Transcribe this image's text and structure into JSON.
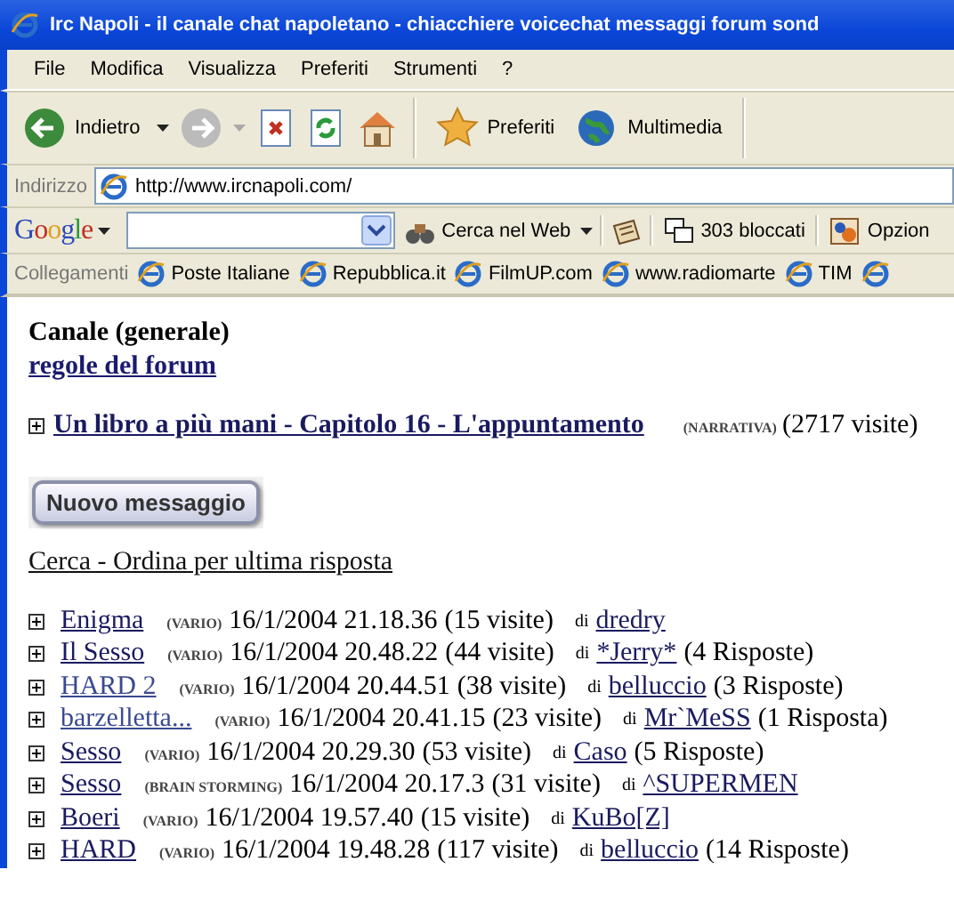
{
  "window": {
    "title": "Irc Napoli - il canale chat napoletano - chiacchiere voicechat messaggi forum sond"
  },
  "menu": [
    "File",
    "Modifica",
    "Visualizza",
    "Preferiti",
    "Strumenti",
    "?"
  ],
  "toolbar": {
    "back": "Indietro",
    "favorites": "Preferiti",
    "media": "Multimedia"
  },
  "address": {
    "label": "Indirizzo",
    "url": "http://www.ircnapoli.com/"
  },
  "google_bar": {
    "logo": "Google",
    "search_button": "Cerca nel Web",
    "blocked": "303 bloccati",
    "options": "Opzion"
  },
  "links_bar": {
    "label": "Collegamenti",
    "links": [
      "Poste Italiane",
      "Repubblica.it",
      "FilmUP.com",
      "www.radiomarte",
      "TIM"
    ]
  },
  "page": {
    "heading": "Canale (generale)",
    "rules_link": "regole del forum",
    "featured": {
      "expanded": false,
      "title": "Un libro a più mani - Capitolo 16 - L'appuntamento",
      "category": "(NARRATIVA)",
      "visits": "(2717 visite)"
    },
    "new_button": "Nuovo messaggio",
    "search_link": "Cerca - Ordina per ultima risposta",
    "threads": [
      {
        "expanded": false,
        "visited": false,
        "title": "Enigma",
        "category": "(VARIO)",
        "date": "16/1/2004 21.18.36",
        "visits": "(15 visite)",
        "by": "di",
        "author": "dredry"
      },
      {
        "expanded": false,
        "visited": false,
        "title": "Il Sesso",
        "category": "(VARIO)",
        "date": "16/1/2004 20.48.22",
        "visits": "(44 visite)",
        "by": "di",
        "author": "*Jerry*",
        "replies": "(4 Risposte)"
      },
      {
        "expanded": false,
        "visited": true,
        "title": "HARD 2",
        "category": "(VARIO)",
        "date": "16/1/2004 20.44.51",
        "visits": "(38 visite)",
        "by": "di",
        "author": "belluccio",
        "replies": "(3 Risposte)"
      },
      {
        "expanded": false,
        "visited": true,
        "title": "barzelletta...",
        "category": "(VARIO)",
        "date": "16/1/2004 20.41.15",
        "visits": "(23 visite)",
        "by": "di",
        "author": "Mr`MeSS",
        "replies": "(1 Risposta)"
      },
      {
        "expanded": false,
        "visited": false,
        "title": "Sesso",
        "category": "(VARIO)",
        "date": "16/1/2004 20.29.30",
        "visits": "(53 visite)",
        "by": "di",
        "author": "Caso",
        "replies": "(5 Risposte)"
      },
      {
        "expanded": false,
        "visited": false,
        "title": "Sesso",
        "category": "(BRAIN STORMING)",
        "date": "16/1/2004 20.17.3",
        "visits": "(31 visite)",
        "by": "di",
        "author": "^SUPERMEN"
      },
      {
        "expanded": false,
        "visited": false,
        "title": "Boeri",
        "category": "(VARIO)",
        "date": "16/1/2004 19.57.40",
        "visits": "(15 visite)",
        "by": "di",
        "author": "KuBo[Z]"
      },
      {
        "expanded": false,
        "visited": false,
        "title": "HARD",
        "category": "(VARIO)",
        "date": "16/1/2004 19.48.28",
        "visits": "(117 visite)",
        "by": "di",
        "author": "belluccio",
        "replies": "(14 Risposte)"
      }
    ]
  }
}
